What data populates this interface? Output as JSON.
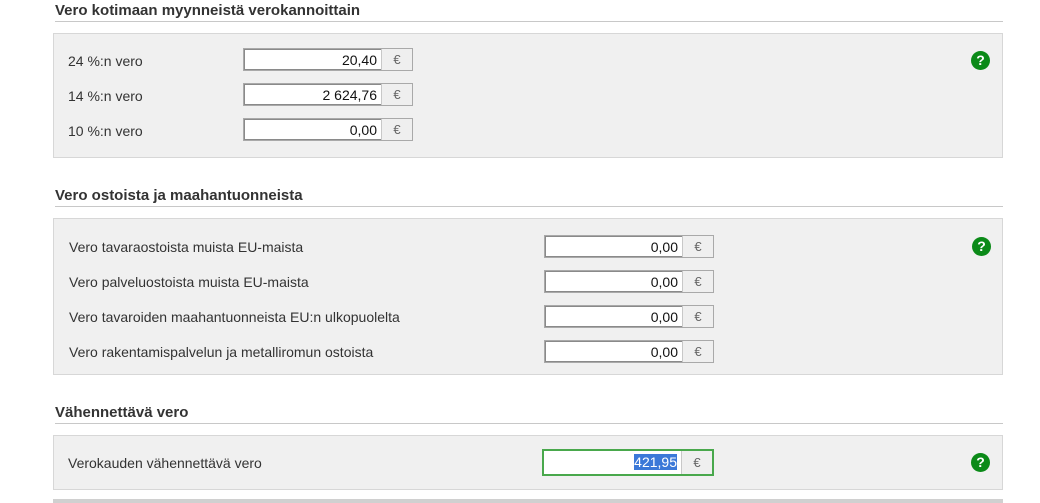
{
  "domestic": {
    "title": "Vero kotimaan myynneistä verokannoittain",
    "rows": [
      {
        "label": "24 %:n vero",
        "value": "20,40",
        "unit": "€"
      },
      {
        "label": "14 %:n vero",
        "value": "2 624,76",
        "unit": "€"
      },
      {
        "label": "10 %:n vero",
        "value": "0,00",
        "unit": "€"
      }
    ],
    "help": "?"
  },
  "purchases": {
    "title": "Vero ostoista ja maahantuonneista",
    "rows": [
      {
        "label": "Vero tavaraostoista muista EU-maista",
        "value": "0,00",
        "unit": "€"
      },
      {
        "label": "Vero palveluostoista muista EU-maista",
        "value": "0,00",
        "unit": "€"
      },
      {
        "label": "Vero tavaroiden maahantuonneista EU:n ulkopuolelta",
        "value": "0,00",
        "unit": "€"
      },
      {
        "label": "Vero rakentamispalvelun ja metalliromun ostoista",
        "value": "0,00",
        "unit": "€"
      }
    ],
    "help": "?"
  },
  "deductible": {
    "title": "Vähennettävä vero",
    "rows": [
      {
        "label": "Verokauden vähennettävä vero",
        "value": "421,95",
        "unit": "€"
      }
    ],
    "help": "?"
  }
}
